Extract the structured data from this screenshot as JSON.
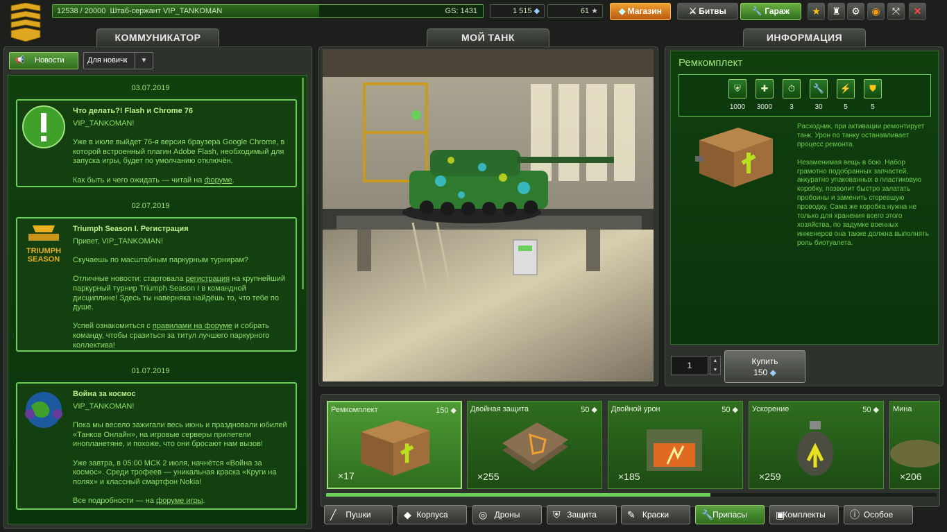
{
  "topbar": {
    "xp_text": "12538 / 20000",
    "rank_text": "Штаб-сержант VIP_TANKOMAN",
    "gs": "GS: 1431",
    "crystals": "1 515",
    "stars": "61",
    "shop": "Магазин",
    "battles": "Битвы",
    "garage": "Гараж"
  },
  "left": {
    "tab": "КОММУНИКАТОР",
    "news_btn": "Новости",
    "filter": "Для новичк",
    "news": [
      {
        "date": "03.07.2019",
        "title": "Что делать?! Flash и Chrome 76",
        "body": "VIP_TANKOMAN!\n\nУже в июле выйдет 76-я версия браузера Google Chrome, в которой встроенный плагин Adobe Flash, необходимый для запуска игры, будет по умолчанию отключён.\n\nКак быть и чего ожидать — читай на ",
        "link": "форуме",
        "tail": "."
      },
      {
        "date": "02.07.2019",
        "title": "Triumph Season I. Регистрация",
        "body": "Привет, VIP_TANKOMAN!\n\nСкучаешь по масштабным паркурным турнирам?\n\nОтличные новости: стартовала ",
        "link": "регистрация",
        "tail": " на крупнейший паркурный турнир Triumph Season I в командной дисциплине! Здесь ты наверняка найдёшь то, что тебе по душе.\n\nУспей ознакомиться с ",
        "link2": "правилами на форуме",
        "tail2": " и собрать команду, чтобы сразиться за титул лучшего паркурного коллектива!",
        "logo": "TRIUMPH SEASON"
      },
      {
        "date": "01.07.2019",
        "title": "Война за космос",
        "body": "VIP_TANKOMAN!\n\nПока мы весело зажигали весь июнь и праздновали юбилей «Танков Онлайн», на игровые серверы прилетели инопланетяне, и похоже, что они бросают нам вызов!\n\nУже завтра, в 05:00 МСК 2 июля, начнётся «Война за космос». Среди трофеев — уникальная краска «Круги на полях» и классный смартфон Nokia!\n\nВсе подробности — на ",
        "link": "форуме игры",
        "tail": "."
      }
    ]
  },
  "center": {
    "tab": "МОЙ ТАНК"
  },
  "right": {
    "tab": "ИНФОРМАЦИЯ",
    "title": "Ремкомплект",
    "upgrades": [
      "1000",
      "3000",
      "3",
      "30",
      "5",
      "5"
    ],
    "desc": "Расходник, при активации ремонтирует танк. Урон по танку останавливает процесс ремонта.\n\nНезаменимая вещь в бою. Набор грамотно подобранных запчастей, аккуратно упакованных в пластиковую коробку, позволит быстро залатать пробоины и заменить сгоревшую проводку. Сама же коробка нужна не только для хранения всего этого хозяйства, по задумке военных инженеров она также должна выполнять роль биотуалета.",
    "qty": "1",
    "buy": "Купить",
    "price": "150"
  },
  "items": [
    {
      "name": "Ремкомплект",
      "price": "150",
      "count": "×17"
    },
    {
      "name": "Двойная защита",
      "price": "50",
      "count": "×255"
    },
    {
      "name": "Двойной урон",
      "price": "50",
      "count": "×185"
    },
    {
      "name": "Ускорение",
      "price": "50",
      "count": "×259"
    },
    {
      "name": "Мина",
      "price": "",
      "count": "×206"
    }
  ],
  "categories": [
    "Пушки",
    "Корпуса",
    "Дроны",
    "Защита",
    "Краски",
    "Припасы",
    "Комплекты",
    "Особое"
  ],
  "scroll_progress": 0.63
}
